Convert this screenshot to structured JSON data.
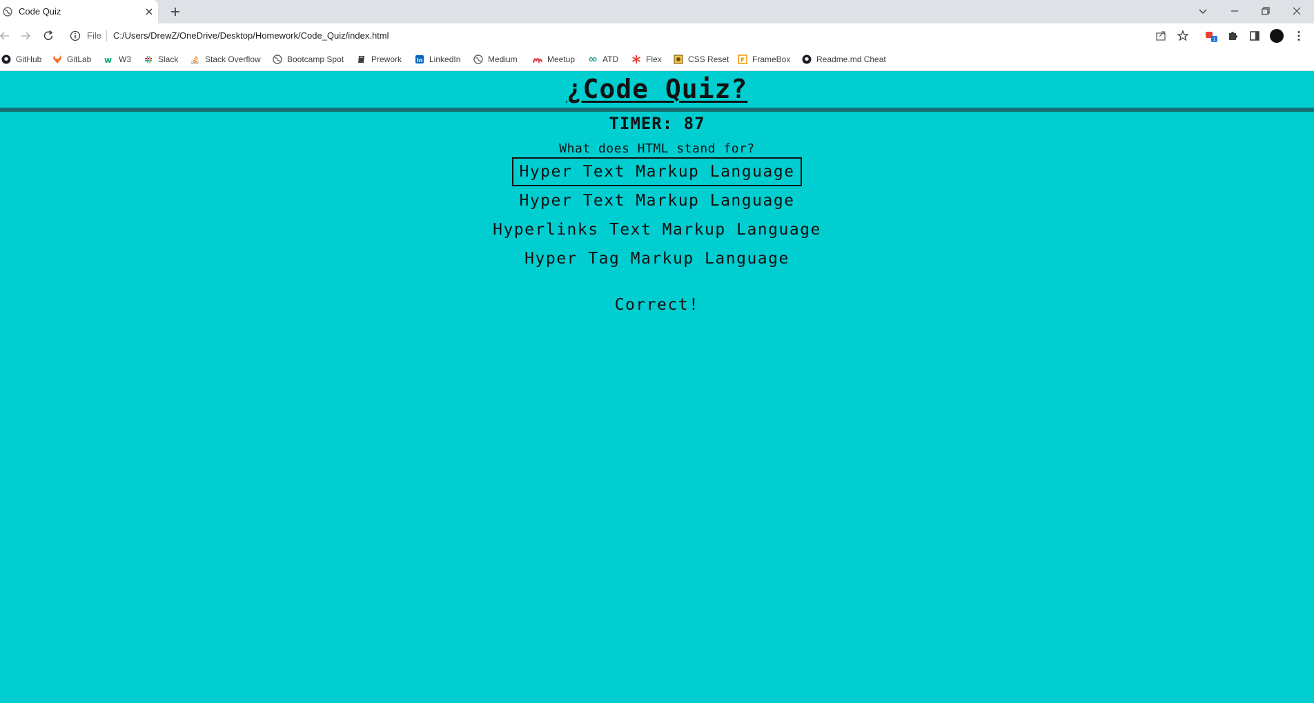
{
  "browser": {
    "tab": {
      "title": "Code Quiz",
      "favicon": "globe-icon"
    },
    "address_bar": {
      "scheme_label": "File",
      "url": "C:/Users/DrewZ/OneDrive/Desktop/Homework/Code_Quiz/index.html"
    },
    "bookmarks": [
      {
        "label": "GitHub",
        "icon": "github-icon"
      },
      {
        "label": "GitLab",
        "icon": "gitlab-icon"
      },
      {
        "label": "W3",
        "icon": "w3-icon"
      },
      {
        "label": "Slack",
        "icon": "slack-icon"
      },
      {
        "label": "Stack Overflow",
        "icon": "stack-overflow-icon"
      },
      {
        "label": "Bootcamp Spot",
        "icon": "globe-icon"
      },
      {
        "label": "Prework",
        "icon": "book-icon"
      },
      {
        "label": "LinkedIn",
        "icon": "linkedin-icon"
      },
      {
        "label": "Medium",
        "icon": "globe-icon"
      },
      {
        "label": "Meetup",
        "icon": "meetup-icon"
      },
      {
        "label": "ATD",
        "icon": "infinity-icon"
      },
      {
        "label": "Flex",
        "icon": "asterisk-icon"
      },
      {
        "label": "CSS Reset",
        "icon": "css-reset-icon"
      },
      {
        "label": "FrameBox",
        "icon": "framebox-icon"
      },
      {
        "label": "Readme.md Cheat",
        "icon": "github-icon"
      }
    ]
  },
  "quiz": {
    "title": "¿Code Quiz?",
    "timer_label": "TIMER: 87",
    "question": "What does HTML stand for?",
    "answers": [
      {
        "label": "Hyper Text Markup Language",
        "selected": true
      },
      {
        "label": "Hyper Text Markup Language",
        "selected": false
      },
      {
        "label": "Hyperlinks Text Markup Language",
        "selected": false
      },
      {
        "label": "Hyper Tag Markup Language",
        "selected": false
      }
    ],
    "feedback": "Correct!"
  },
  "colors": {
    "page_background": "#00ced1",
    "header_rule": "#166d74",
    "text": "#111111"
  }
}
